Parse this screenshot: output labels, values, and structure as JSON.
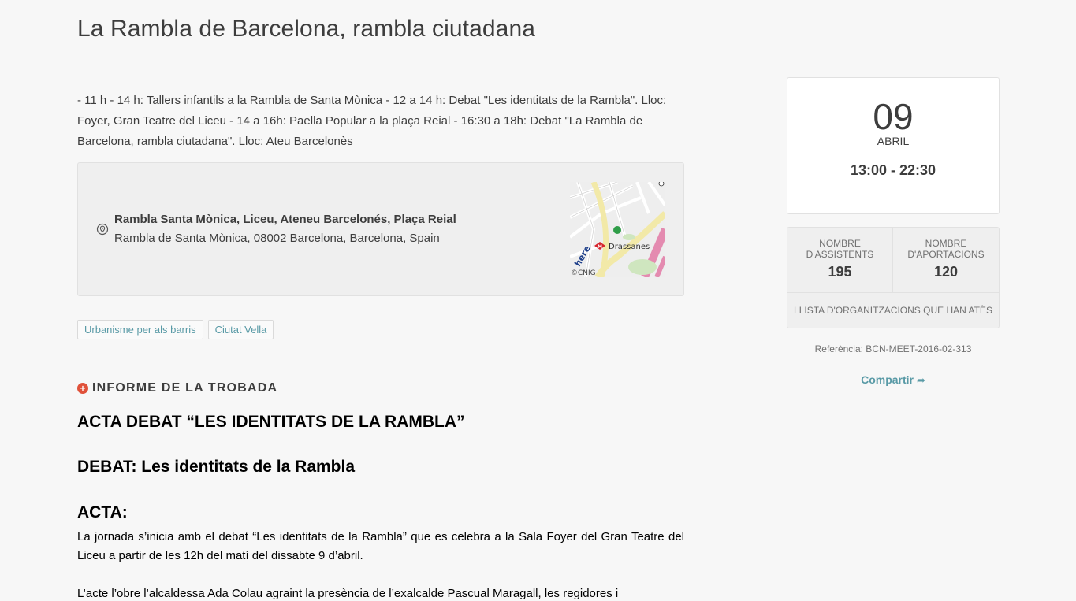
{
  "meeting": {
    "title": "La Rambla de Barcelona, rambla ciutadana",
    "description": "- 11 h - 14 h: Tallers infantils a la Rambla de Santa Mònica - 12 a 14 h: Debat \"Les identitats de la Rambla\". Lloc: Foyer, Gran Teatre del Liceu - 14 a 16h: Paella Popular a la plaça Reial - 16:30 a 18h: Debat \"La Rambla de Barcelona, rambla ciutadana\". Lloc: Ateu Barcelonès"
  },
  "location": {
    "name": "Rambla Santa Mònica, Liceu, Ateneu Barcelonés, Plaça Reial",
    "address": "Rambla de Santa Mònica, 08002 Barcelona, Barcelona, Spain",
    "map": {
      "station_label": "Drassanes",
      "provider_logo": "here",
      "copyright": "©CNIG"
    }
  },
  "tags": [
    "Urbanisme per als barris",
    "Ciutat Vella"
  ],
  "report": {
    "section_title": "INFORME DE LA TROBADA",
    "heading1": "ACTA DEBAT “LES IDENTITATS DE LA RAMBLA”",
    "heading2": "DEBAT: Les identitats de la Rambla",
    "heading3": "ACTA:",
    "paragraph1": "La jornada s’inicia amb el debat “Les identitats de la Rambla” que es celebra a la Sala Foyer del Gran Teatre del Liceu a partir de les 12h del matí del dissabte 9 d’abril.",
    "paragraph2": "L’acte l’obre l’alcaldessa Ada Colau agraint la presència de l’exalcalde Pascual Maragall, les regidores i"
  },
  "date": {
    "day": "09",
    "month": "ABRIL",
    "time": "13:00 - 22:30"
  },
  "stats": {
    "attendees_label": "NOMBRE D'ASSISTENTS",
    "attendees_value": "195",
    "contributions_label": "NOMBRE D'APORTACIONS",
    "contributions_value": "120",
    "organizations_link": "LLISTA D'ORGANITZACIONS QUE HAN ATÈS"
  },
  "reference": "Referència: BCN-MEET-2016-02-313",
  "share_label": "Compartir",
  "colors": {
    "accent": "#599aa6",
    "report_icon": "#e0513a",
    "background": "#f7f7f7"
  }
}
